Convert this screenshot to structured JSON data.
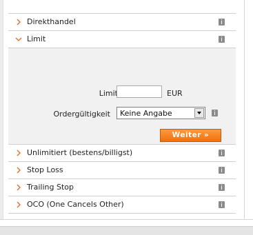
{
  "rows_top": [
    {
      "label": "Direkthandel",
      "expanded": false
    },
    {
      "label": "Limit",
      "expanded": true
    }
  ],
  "limit_form": {
    "limit_label": "Limit",
    "limit_value": "",
    "currency": "EUR",
    "validity_label": "Ordergültigkeit",
    "validity_value": "Keine Angabe",
    "submit_label": "Weiter »"
  },
  "rows_bottom": [
    {
      "label": "Unlimitiert (bestens/billigst)"
    },
    {
      "label": "Stop Loss"
    },
    {
      "label": "Trailing Stop"
    },
    {
      "label": "OCO (One Cancels Other)"
    }
  ],
  "colors": {
    "chevron": "#e8671e",
    "button": "#f07010",
    "info_icon": "#8a8a8a"
  }
}
